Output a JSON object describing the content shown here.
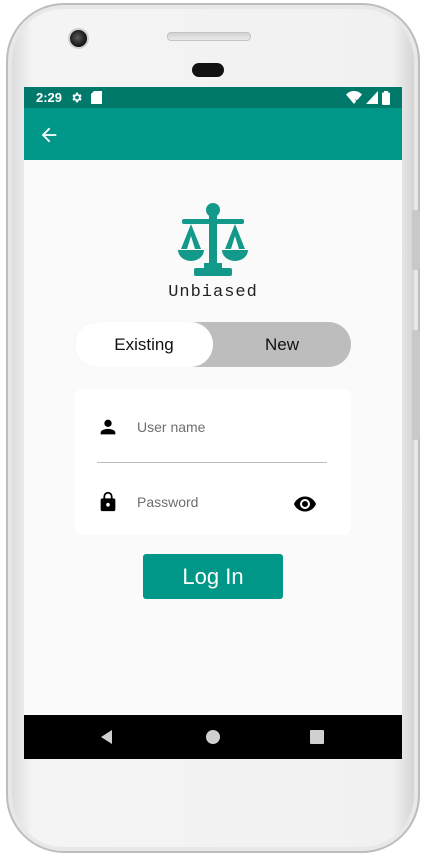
{
  "status_bar": {
    "time": "2:29",
    "left_icons": [
      "gear-icon",
      "sd-card-icon"
    ],
    "right_icons": [
      "wifi-icon",
      "signal-icon",
      "battery-icon"
    ]
  },
  "app_bar": {
    "back_icon": "arrow-back-icon"
  },
  "logo": {
    "icon": "scales-of-justice-icon",
    "name": "Unbiased"
  },
  "toggle": {
    "existing_label": "Existing",
    "new_label": "New",
    "selected": "Existing"
  },
  "form": {
    "username": {
      "placeholder": "User name",
      "value": "",
      "icon": "person-icon"
    },
    "password": {
      "placeholder": "Password",
      "value": "",
      "icon": "lock-icon",
      "visibility_icon": "eye-icon"
    }
  },
  "login_button": {
    "label": "Log In"
  },
  "nav_bar": {
    "buttons": [
      "back-triangle-icon",
      "home-circle-icon",
      "recents-square-icon"
    ]
  },
  "colors": {
    "primary": "#009688",
    "primary_dark": "#00796b",
    "toggle_bg": "#bdbdbd",
    "background": "#fafafa"
  }
}
